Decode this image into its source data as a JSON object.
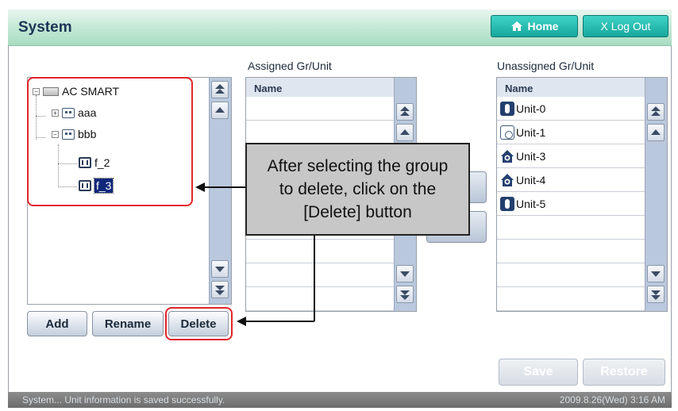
{
  "header": {
    "title": "System",
    "home_label": "Home",
    "logout_label": "X Log Out"
  },
  "tree": {
    "nodes": [
      {
        "label": "AC SMART",
        "expander": "−"
      },
      {
        "label": "aaa",
        "expander": "+"
      },
      {
        "label": "bbb",
        "expander": "−"
      },
      {
        "label": "f_2"
      },
      {
        "label": "f_3",
        "selected": true
      }
    ],
    "buttons": {
      "add": "Add",
      "rename": "Rename",
      "delete": "Delete"
    }
  },
  "assigned": {
    "title": "Assigned Gr/Unit",
    "column": "Name",
    "rows": []
  },
  "unassigned": {
    "title": "Unassigned Gr/Unit",
    "column": "Name",
    "rows": [
      {
        "label": "Unit-0",
        "icon": "indoor-unit-icon"
      },
      {
        "label": "Unit-1",
        "icon": "ventilation-unit-icon"
      },
      {
        "label": "Unit-3",
        "icon": "house-unit-icon"
      },
      {
        "label": "Unit-4",
        "icon": "house-unit-icon"
      },
      {
        "label": "Unit-5",
        "icon": "indoor-unit-icon"
      }
    ]
  },
  "callout": {
    "line1": "After selecting the group",
    "line2": "to delete, click on the",
    "line3": "[Delete] button"
  },
  "footer_buttons": {
    "save": "Save",
    "restore": "Restore"
  },
  "status": {
    "message": "System... Unit information is saved successfully.",
    "datetime": "2009.8.26(Wed)  3:16 AM"
  },
  "colors": {
    "accent": "#18a79d",
    "highlight": "#e0262b",
    "selection": "#10287a"
  }
}
